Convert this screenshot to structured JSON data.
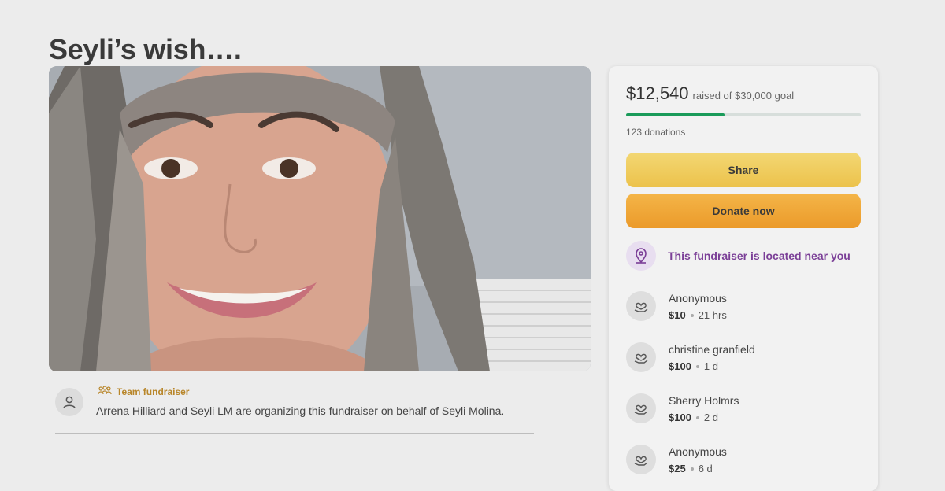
{
  "page": {
    "title": "Seyli’s wish…."
  },
  "organizer": {
    "team_label": "Team fundraiser",
    "text": "Arrena Hilliard and Seyli LM are organizing this fundraiser on behalf of Seyli Molina."
  },
  "summary": {
    "raised": "$12,540",
    "goal_text": "raised of $30,000 goal",
    "progress_fraction": 0.418,
    "donations_count": "123 donations",
    "share_label": "Share",
    "donate_label": "Donate now",
    "location_text": "This fundraiser is located near you"
  },
  "donors": [
    {
      "name": "Anonymous",
      "amount": "$10",
      "time": "21 hrs"
    },
    {
      "name": "christine granfield",
      "amount": "$100",
      "time": "1 d"
    },
    {
      "name": "Sherry Holmrs",
      "amount": "$100",
      "time": "2 d"
    },
    {
      "name": "Anonymous",
      "amount": "$25",
      "time": "6 d"
    }
  ],
  "colors": {
    "progress": "#1a9b5a",
    "share_button": "#ecc24b",
    "donate_button": "#eb9a2a",
    "location_accent": "#7b3f97",
    "team_accent": "#b8862a"
  },
  "icons": {
    "avatar": "user-icon",
    "team": "team-icon",
    "location": "location-pin-icon",
    "donor": "heart-hand-icon"
  }
}
